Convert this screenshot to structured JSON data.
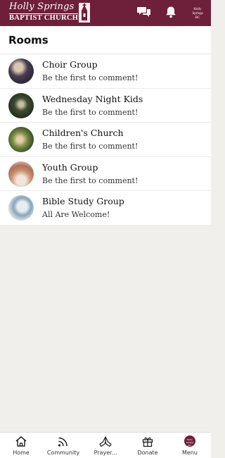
{
  "header": {
    "logo_line1": "Holly Springs",
    "logo_line2": "BAPTIST CHURCH",
    "avatar_text": "Holly Springs BC",
    "brand_color": "#6e1f3a",
    "icons": [
      "chat-bubbles-icon",
      "bell-icon"
    ]
  },
  "page": {
    "title": "Rooms"
  },
  "rooms": [
    {
      "name": "Choir Group",
      "subtitle": "Be the first to comment!"
    },
    {
      "name": "Wednesday Night Kids",
      "subtitle": "Be the first to comment!"
    },
    {
      "name": "Children's Church",
      "subtitle": "Be the first to comment!"
    },
    {
      "name": "Youth Group",
      "subtitle": "Be the first to comment!"
    },
    {
      "name": "Bible Study Group",
      "subtitle": "All Are Welcome!"
    }
  ],
  "tabbar": {
    "tabs": [
      {
        "label": "Home",
        "icon": "home-icon"
      },
      {
        "label": "Community",
        "icon": "rss-icon"
      },
      {
        "label": "Prayer...",
        "icon": "praying-hands-icon"
      },
      {
        "label": "Donate",
        "icon": "gift-icon"
      },
      {
        "label": "Menu",
        "icon": "church-avatar-icon"
      }
    ],
    "menu_avatar_text": "Holly Springs BC"
  }
}
